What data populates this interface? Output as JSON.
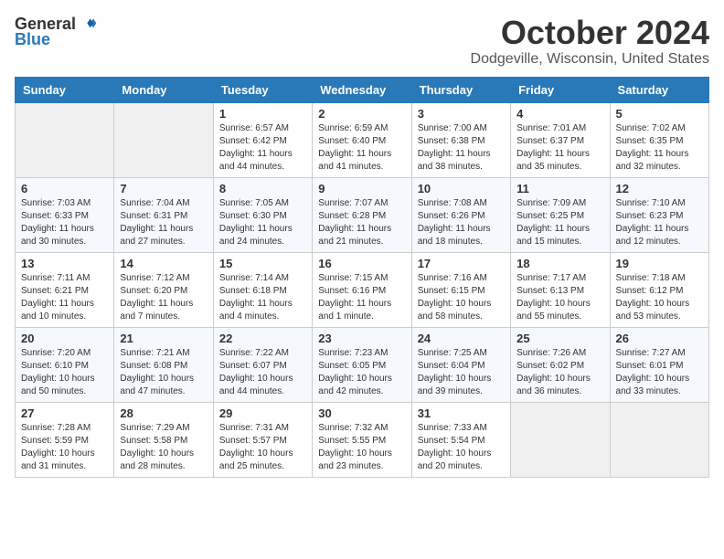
{
  "header": {
    "logo_general": "General",
    "logo_blue": "Blue",
    "month_title": "October 2024",
    "location": "Dodgeville, Wisconsin, United States"
  },
  "calendar": {
    "days_of_week": [
      "Sunday",
      "Monday",
      "Tuesday",
      "Wednesday",
      "Thursday",
      "Friday",
      "Saturday"
    ],
    "weeks": [
      [
        {
          "day": "",
          "info": ""
        },
        {
          "day": "",
          "info": ""
        },
        {
          "day": "1",
          "info": "Sunrise: 6:57 AM\nSunset: 6:42 PM\nDaylight: 11 hours and 44 minutes."
        },
        {
          "day": "2",
          "info": "Sunrise: 6:59 AM\nSunset: 6:40 PM\nDaylight: 11 hours and 41 minutes."
        },
        {
          "day": "3",
          "info": "Sunrise: 7:00 AM\nSunset: 6:38 PM\nDaylight: 11 hours and 38 minutes."
        },
        {
          "day": "4",
          "info": "Sunrise: 7:01 AM\nSunset: 6:37 PM\nDaylight: 11 hours and 35 minutes."
        },
        {
          "day": "5",
          "info": "Sunrise: 7:02 AM\nSunset: 6:35 PM\nDaylight: 11 hours and 32 minutes."
        }
      ],
      [
        {
          "day": "6",
          "info": "Sunrise: 7:03 AM\nSunset: 6:33 PM\nDaylight: 11 hours and 30 minutes."
        },
        {
          "day": "7",
          "info": "Sunrise: 7:04 AM\nSunset: 6:31 PM\nDaylight: 11 hours and 27 minutes."
        },
        {
          "day": "8",
          "info": "Sunrise: 7:05 AM\nSunset: 6:30 PM\nDaylight: 11 hours and 24 minutes."
        },
        {
          "day": "9",
          "info": "Sunrise: 7:07 AM\nSunset: 6:28 PM\nDaylight: 11 hours and 21 minutes."
        },
        {
          "day": "10",
          "info": "Sunrise: 7:08 AM\nSunset: 6:26 PM\nDaylight: 11 hours and 18 minutes."
        },
        {
          "day": "11",
          "info": "Sunrise: 7:09 AM\nSunset: 6:25 PM\nDaylight: 11 hours and 15 minutes."
        },
        {
          "day": "12",
          "info": "Sunrise: 7:10 AM\nSunset: 6:23 PM\nDaylight: 11 hours and 12 minutes."
        }
      ],
      [
        {
          "day": "13",
          "info": "Sunrise: 7:11 AM\nSunset: 6:21 PM\nDaylight: 11 hours and 10 minutes."
        },
        {
          "day": "14",
          "info": "Sunrise: 7:12 AM\nSunset: 6:20 PM\nDaylight: 11 hours and 7 minutes."
        },
        {
          "day": "15",
          "info": "Sunrise: 7:14 AM\nSunset: 6:18 PM\nDaylight: 11 hours and 4 minutes."
        },
        {
          "day": "16",
          "info": "Sunrise: 7:15 AM\nSunset: 6:16 PM\nDaylight: 11 hours and 1 minute."
        },
        {
          "day": "17",
          "info": "Sunrise: 7:16 AM\nSunset: 6:15 PM\nDaylight: 10 hours and 58 minutes."
        },
        {
          "day": "18",
          "info": "Sunrise: 7:17 AM\nSunset: 6:13 PM\nDaylight: 10 hours and 55 minutes."
        },
        {
          "day": "19",
          "info": "Sunrise: 7:18 AM\nSunset: 6:12 PM\nDaylight: 10 hours and 53 minutes."
        }
      ],
      [
        {
          "day": "20",
          "info": "Sunrise: 7:20 AM\nSunset: 6:10 PM\nDaylight: 10 hours and 50 minutes."
        },
        {
          "day": "21",
          "info": "Sunrise: 7:21 AM\nSunset: 6:08 PM\nDaylight: 10 hours and 47 minutes."
        },
        {
          "day": "22",
          "info": "Sunrise: 7:22 AM\nSunset: 6:07 PM\nDaylight: 10 hours and 44 minutes."
        },
        {
          "day": "23",
          "info": "Sunrise: 7:23 AM\nSunset: 6:05 PM\nDaylight: 10 hours and 42 minutes."
        },
        {
          "day": "24",
          "info": "Sunrise: 7:25 AM\nSunset: 6:04 PM\nDaylight: 10 hours and 39 minutes."
        },
        {
          "day": "25",
          "info": "Sunrise: 7:26 AM\nSunset: 6:02 PM\nDaylight: 10 hours and 36 minutes."
        },
        {
          "day": "26",
          "info": "Sunrise: 7:27 AM\nSunset: 6:01 PM\nDaylight: 10 hours and 33 minutes."
        }
      ],
      [
        {
          "day": "27",
          "info": "Sunrise: 7:28 AM\nSunset: 5:59 PM\nDaylight: 10 hours and 31 minutes."
        },
        {
          "day": "28",
          "info": "Sunrise: 7:29 AM\nSunset: 5:58 PM\nDaylight: 10 hours and 28 minutes."
        },
        {
          "day": "29",
          "info": "Sunrise: 7:31 AM\nSunset: 5:57 PM\nDaylight: 10 hours and 25 minutes."
        },
        {
          "day": "30",
          "info": "Sunrise: 7:32 AM\nSunset: 5:55 PM\nDaylight: 10 hours and 23 minutes."
        },
        {
          "day": "31",
          "info": "Sunrise: 7:33 AM\nSunset: 5:54 PM\nDaylight: 10 hours and 20 minutes."
        },
        {
          "day": "",
          "info": ""
        },
        {
          "day": "",
          "info": ""
        }
      ]
    ]
  }
}
